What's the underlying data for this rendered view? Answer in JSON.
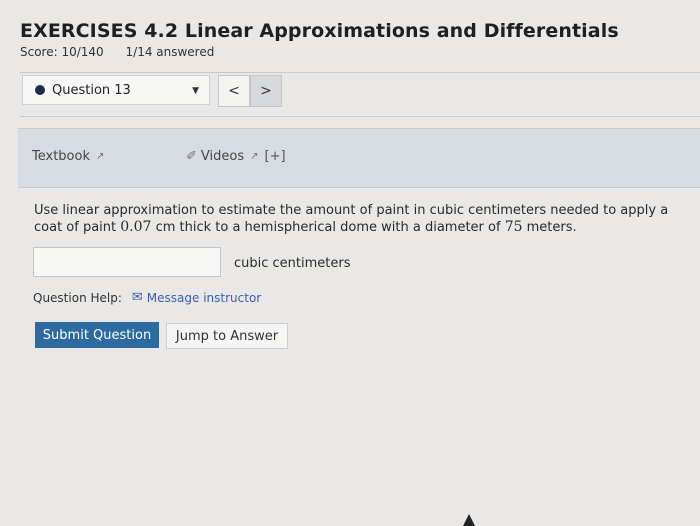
{
  "header": {
    "title": "EXERCISES 4.2 Linear Approximations and Differentials",
    "score": "Score: 10/140",
    "answered": "1/14 answered"
  },
  "question_nav": {
    "selected": "Question 13",
    "prev_label": "<",
    "next_label": ">"
  },
  "resources": {
    "textbook_label": "Textbook",
    "videos_label": "Videos",
    "expand_label": "[+]"
  },
  "problem": {
    "text_1": "Use linear approximation to estimate the amount of paint in cubic centimeters needed to apply a coat of paint ",
    "thickness": "0.07",
    "text_2": " cm thick to a hemispherical dome with a diameter of ",
    "diameter": "75",
    "text_3": " meters."
  },
  "answer": {
    "value": "",
    "unit": "cubic centimeters"
  },
  "help": {
    "label": "Question Help:",
    "message_link": "Message instructor"
  },
  "actions": {
    "submit": "Submit Question",
    "jump": "Jump to Answer"
  }
}
